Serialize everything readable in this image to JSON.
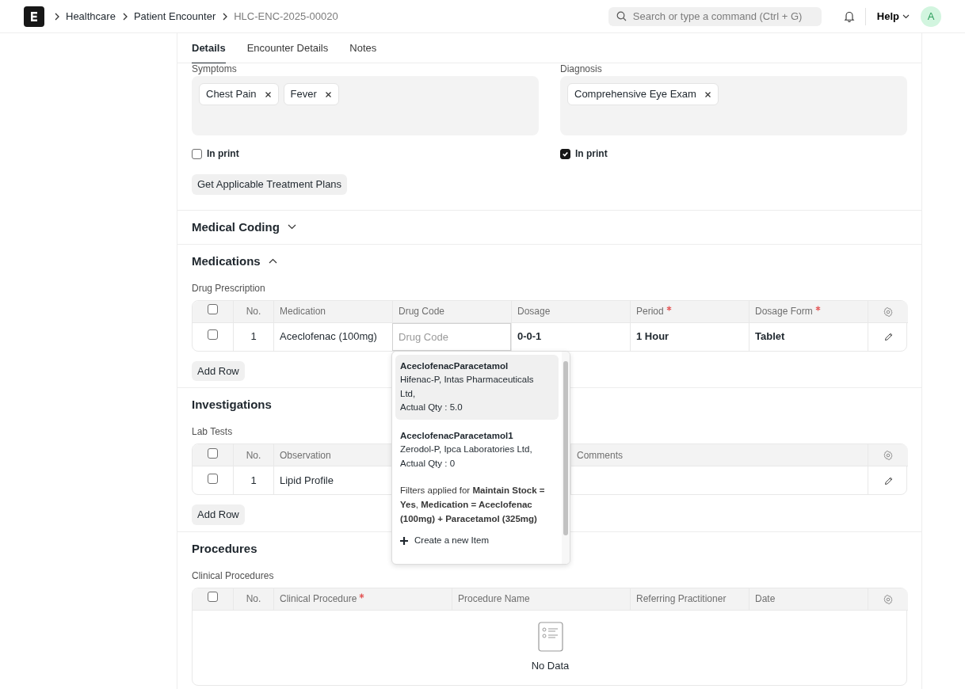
{
  "navbar": {
    "breadcrumbs": [
      {
        "label": "Healthcare",
        "current": false
      },
      {
        "label": "Patient Encounter",
        "current": false
      },
      {
        "label": "HLC-ENC-2025-00020",
        "current": true
      }
    ],
    "search": {
      "placeholder": "Search or type a command (Ctrl + G)"
    },
    "help": "Help",
    "avatar": "A"
  },
  "tabs": [
    {
      "label": "Details",
      "selected": true
    },
    {
      "label": "Encounter Details",
      "selected": false
    },
    {
      "label": "Notes",
      "selected": false
    }
  ],
  "fields": [
    {
      "label": "Symptoms",
      "pills": [
        "Chest Pain",
        "Fever"
      ],
      "print": {
        "label": "In print",
        "checked": false
      }
    },
    {
      "label": "Diagnosis",
      "pills": [
        "Comprehensive Eye Exam"
      ],
      "print": {
        "label": "In print",
        "checked": true
      }
    }
  ],
  "treatment_button": "Get Applicable Treatment Plans",
  "sections": [
    {
      "title": "Medical Coding",
      "expanded": false
    },
    {
      "title": "Medications",
      "expanded": true,
      "table": {
        "label": "Drug Prescription",
        "all_checked": false,
        "columns": [
          {
            "label": "No.",
            "required": false
          },
          {
            "label": "Medication",
            "required": false
          },
          {
            "label": "Drug Code",
            "required": false
          },
          {
            "label": "Dosage",
            "required": false
          },
          {
            "label": "Period",
            "required": true
          },
          {
            "label": "Dosage Form",
            "required": true
          }
        ],
        "rows": [
          {
            "checked": false,
            "cells": [
              {
                "kind": "number",
                "text": "1"
              },
              {
                "kind": "text",
                "text": "Aceclofenac (100mg)"
              },
              {
                "kind": "field",
                "placeholder": "Drug Code"
              },
              {
                "kind": "bold",
                "text": "0-0-1"
              },
              {
                "kind": "bold",
                "text": "1 Hour"
              },
              {
                "kind": "bold",
                "text": "Tablet"
              }
            ]
          }
        ],
        "add_row": "Add Row",
        "dropdown": {
          "items": [
            {
              "title": "AceclofenacParacetamol",
              "description": "Hifenac-P, Intas Pharmaceuticals Ltd,",
              "qty": "Actual Qty : 5.0",
              "selected": true
            },
            {
              "title": "AceclofenacParacetamol1",
              "description": "Zerodol-P, Ipca Laboratories Ltd,",
              "qty": "Actual Qty : 0",
              "selected": false
            }
          ],
          "filter_note": "Filters applied for **Maintain Stock = Yes**, **Medication = Aceclofenac (100mg) + Paracetamol (325mg)**",
          "create": "Create a new Item"
        }
      }
    },
    {
      "title": "Investigations",
      "table": {
        "label": "Lab Tests",
        "all_checked": false,
        "columns": [
          {
            "label": "No.",
            "required": false
          },
          {
            "label": "Observation",
            "required": false
          },
          {
            "label": "Comments",
            "required": false
          }
        ],
        "rows": [
          {
            "checked": false,
            "cells": [
              {
                "kind": "number",
                "text": "1"
              },
              {
                "kind": "text",
                "text": "Lipid Profile"
              },
              {
                "kind": "empty"
              }
            ]
          }
        ],
        "add_row": "Add Row"
      }
    },
    {
      "title": "Procedures",
      "table": {
        "label": "Clinical Procedures",
        "all_checked": false,
        "columns": [
          {
            "label": "No.",
            "required": false
          },
          {
            "label": "Clinical Procedure",
            "required": true
          },
          {
            "label": "Procedure Name",
            "required": false
          },
          {
            "label": "Referring Practitioner",
            "required": false
          },
          {
            "label": "Date",
            "required": false
          }
        ],
        "empty": "No Data"
      }
    }
  ]
}
